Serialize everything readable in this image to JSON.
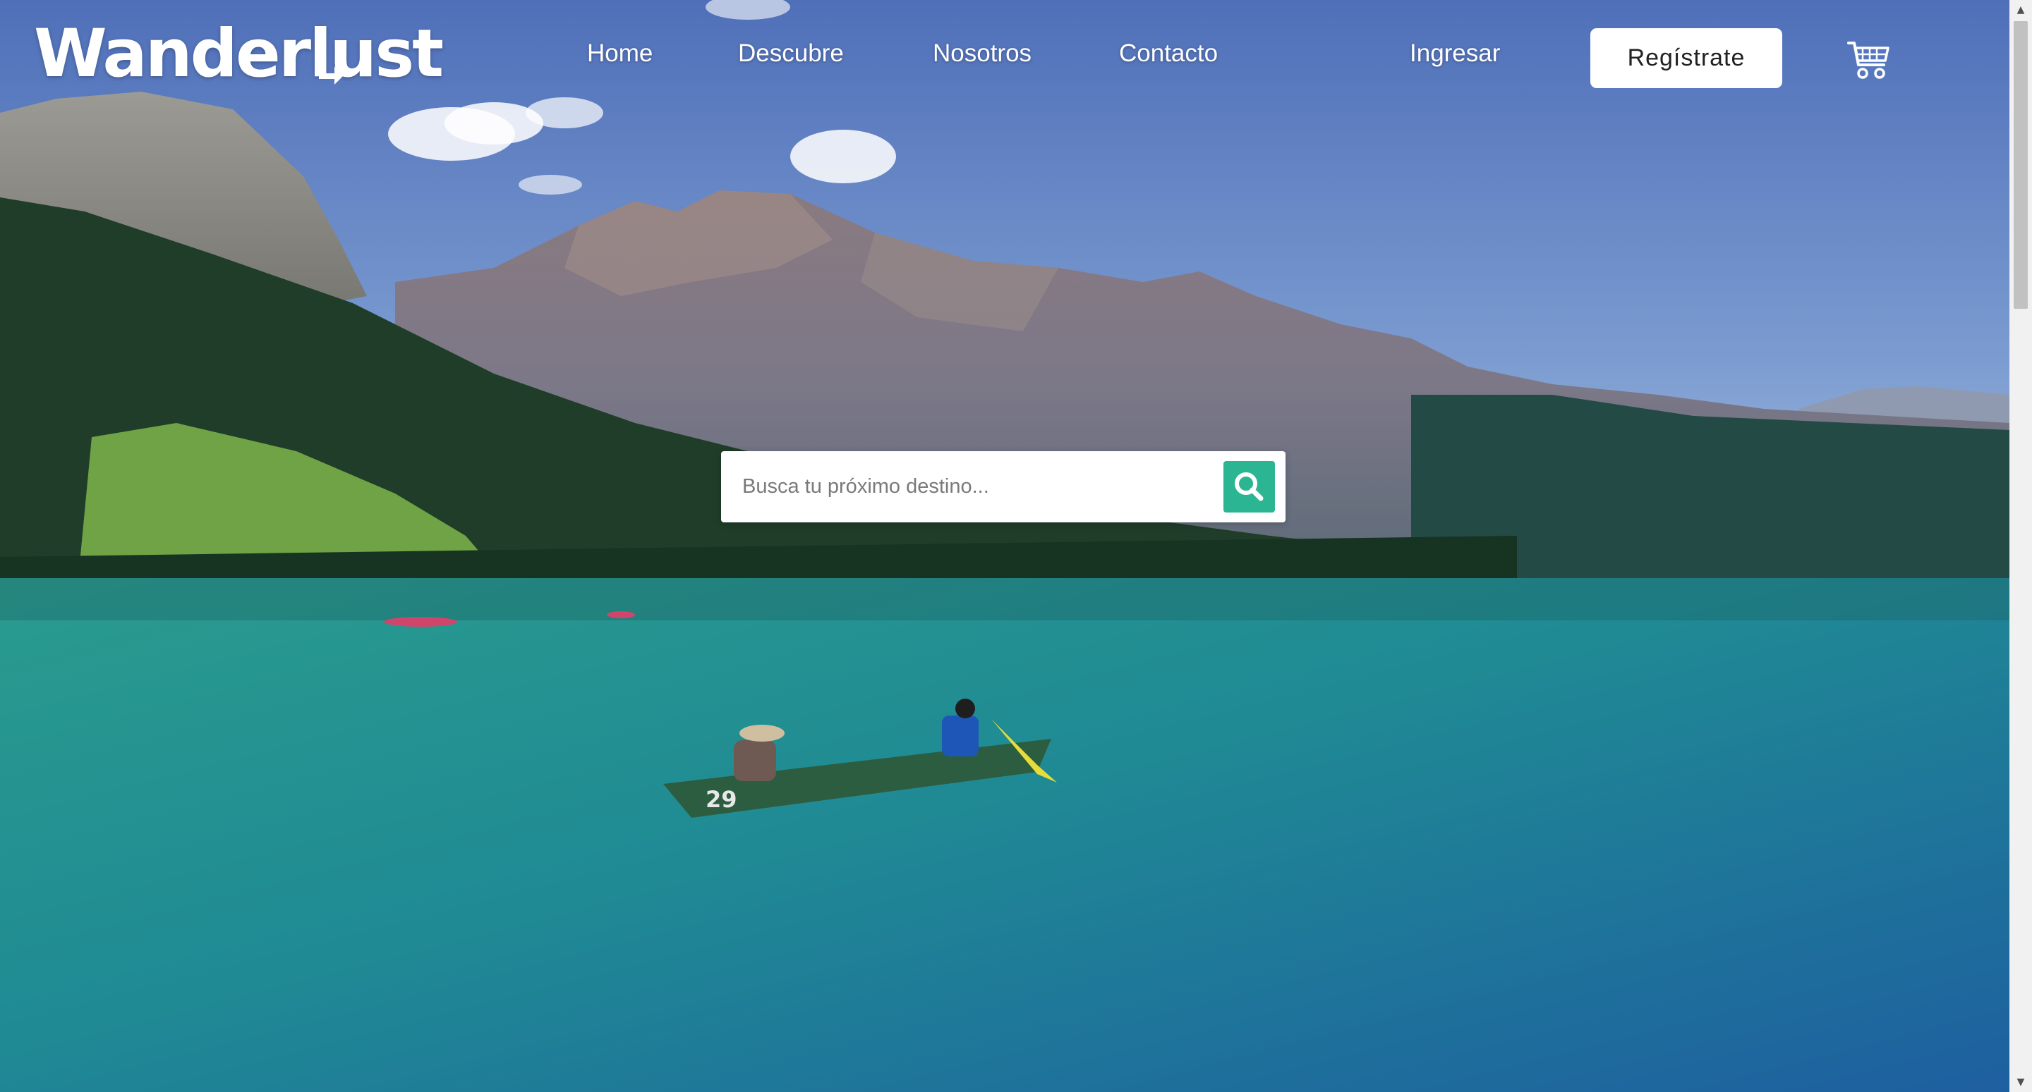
{
  "brand": {
    "logo_text": "Wanderlust"
  },
  "nav": {
    "home": "Home",
    "descubre": "Descubre",
    "nosotros": "Nosotros",
    "contacto": "Contacto",
    "ingresar": "Ingresar",
    "register_label": "Regístrate",
    "cart_icon": "shopping-cart-icon"
  },
  "search": {
    "placeholder": "Busca tu próximo destino...",
    "value": "",
    "button_icon": "search-icon"
  },
  "hero": {
    "canoe_number": "29",
    "accent_color": "#2bb593",
    "sky_color": "#5577bf",
    "lake_color": "#1f8a94"
  }
}
